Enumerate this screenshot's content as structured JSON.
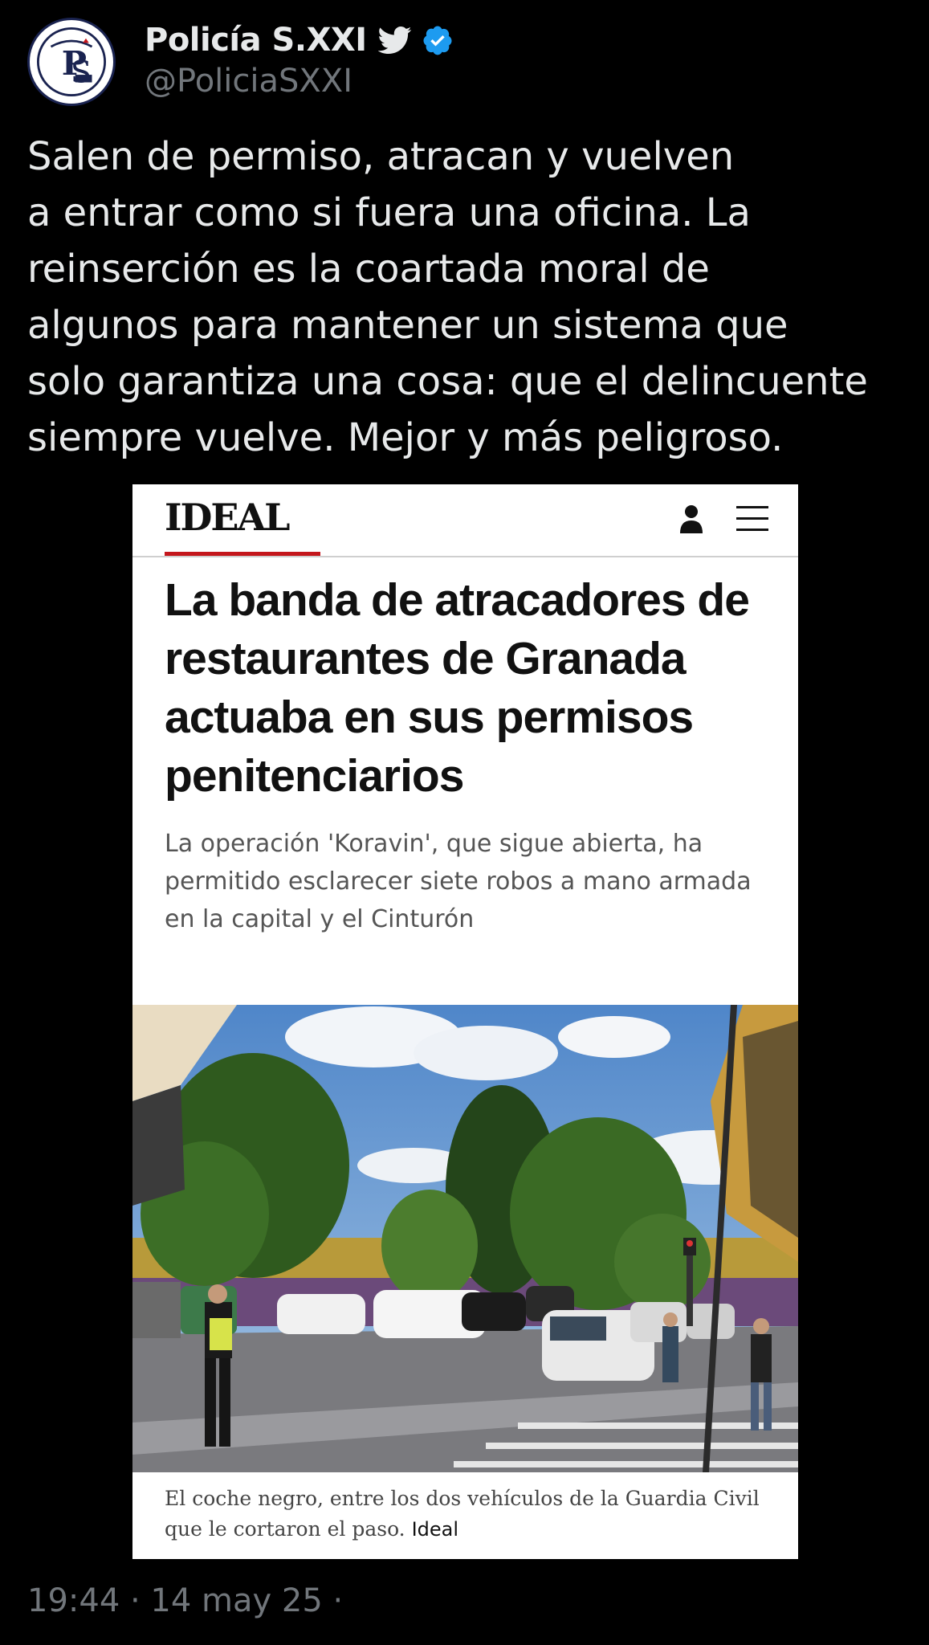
{
  "author": {
    "display_name": "Policía S.XXI",
    "handle": "@PoliciaSXXI",
    "avatar_icon": "police-badge-logo",
    "bird_icon": "twitter-bird-icon",
    "verified_icon": "verified-badge-icon",
    "verified_color": "#1d9bf0"
  },
  "tweet": {
    "text": "Salen de permiso, atracan y vuelven\na entrar como si fuera una oficina. La\nreinserción es la coartada moral de\nalgunos para mantener un sistema que\nsolo garantiza una cosa: que el delincuente\nsiempre vuelve. Mejor y más peligroso.",
    "timestamp": "19:44 · 14 may 25 ·"
  },
  "article": {
    "logo": "IDEAL",
    "accent_color": "#c4161c",
    "headline": "La banda de atracadores de restaurantes de Granada actuaba en sus permisos penitenciarios",
    "lede": "La operación 'Koravin', que sigue abierta, ha permitido esclarecer siete robos a mano armada en la capital y el Cinturón",
    "caption": "El coche negro, entre los dos vehículos de la Guardia Civil que le cortaron el paso.",
    "caption_credit": "Ideal"
  }
}
